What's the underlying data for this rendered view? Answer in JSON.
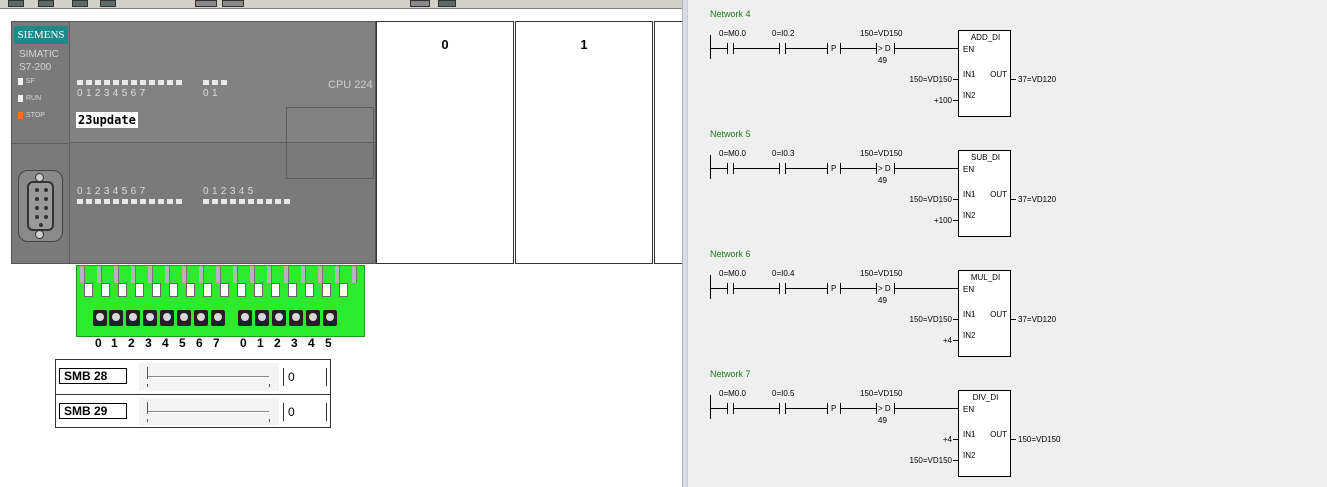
{
  "simulator": {
    "cpu": {
      "brand": "SIEMENS",
      "family_line1": "SIMATIC",
      "family_line2": "S7-200",
      "led_sf": "SF",
      "led_run": "RUN",
      "led_stop": "STOP",
      "model": "CPU 224",
      "program_name": "23update",
      "input_numbers_top": "0 1 2 3 4 5 6 7",
      "input_numbers_top2": "0 1",
      "output_numbers_bottom": "0 1 2 3 4 5 6 7",
      "output_numbers_bottom2": "0 1 2 3 4 5"
    },
    "modules": [
      {
        "label": "0"
      },
      {
        "label": "1"
      }
    ],
    "input_switch_numbers": [
      "0",
      "1",
      "2",
      "3",
      "4",
      "5",
      "6",
      "7",
      "0",
      "1",
      "2",
      "3",
      "4",
      "5"
    ],
    "analog": [
      {
        "label": "SMB 28",
        "value": "0"
      },
      {
        "label": "SMB 29",
        "value": "0"
      }
    ]
  },
  "ladder": {
    "networks": [
      {
        "title": "Network 4",
        "contact1": "0=M0.0",
        "contact2": "0=I0.2",
        "compare_top": "150=VD150",
        "compare_op": "> D",
        "compare_bottom": "49",
        "p_label": "P",
        "box": "ADD_DI",
        "en": "EN",
        "in1_val": "150=VD150",
        "in1": "IN1",
        "out": "OUT",
        "out_val": "37=VD120",
        "in2_val": "+100",
        "in2": "IN2"
      },
      {
        "title": "Network 5",
        "contact1": "0=M0.0",
        "contact2": "0=I0.3",
        "compare_top": "150=VD150",
        "compare_op": "> D",
        "compare_bottom": "49",
        "p_label": "P",
        "box": "SUB_DI",
        "en": "EN",
        "in1_val": "150=VD150",
        "in1": "IN1",
        "out": "OUT",
        "out_val": "37=VD120",
        "in2_val": "+100",
        "in2": "IN2"
      },
      {
        "title": "Network 6",
        "contact1": "0=M0.0",
        "contact2": "0=I0.4",
        "compare_top": "150=VD150",
        "compare_op": "> D",
        "compare_bottom": "49",
        "p_label": "P",
        "box": "MUL_DI",
        "en": "EN",
        "in1_val": "150=VD150",
        "in1": "IN1",
        "out": "OUT",
        "out_val": "37=VD120",
        "in2_val": "+4",
        "in2": "IN2"
      },
      {
        "title": "Network 7",
        "contact1": "0=M0.0",
        "contact2": "0=I0.5",
        "compare_top": "150=VD150",
        "compare_op": "> D",
        "compare_bottom": "49",
        "p_label": "P",
        "box": "DIV_DI",
        "en": "EN",
        "in1_val": "+4",
        "in1": "IN1",
        "out": "OUT",
        "out_val": "150=VD150",
        "in2_val": "150=VD150",
        "in2": "IN2"
      }
    ]
  }
}
